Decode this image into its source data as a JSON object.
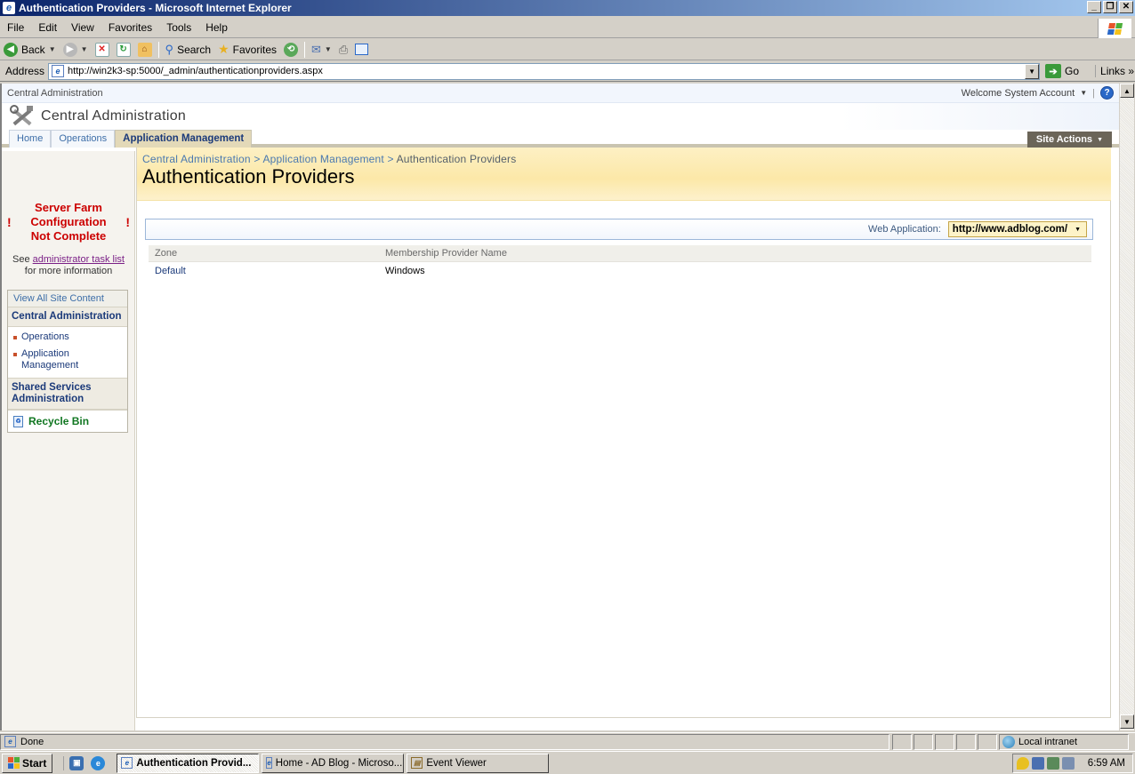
{
  "window": {
    "title": "Authentication Providers - Microsoft Internet Explorer"
  },
  "menu": [
    "File",
    "Edit",
    "View",
    "Favorites",
    "Tools",
    "Help"
  ],
  "toolbar": {
    "back": "Back",
    "search": "Search",
    "favorites": "Favorites"
  },
  "address": {
    "label": "Address",
    "url": "http://win2k3-sp:5000/_admin/authenticationproviders.aspx",
    "go": "Go",
    "links": "Links"
  },
  "sp": {
    "top_left": "Central Administration",
    "welcome": "Welcome System Account",
    "site_title": "Central Administration",
    "tabs": [
      "Home",
      "Operations",
      "Application Management"
    ],
    "active_tab": "Application Management",
    "site_actions": "Site Actions"
  },
  "leftnav": {
    "warning_lines": [
      "Server Farm",
      "Configuration",
      "Not Complete"
    ],
    "see_prefix": "See",
    "see_link": "administrator task list",
    "see_suffix": "for more information",
    "view_all": "View All Site Content",
    "central_admin": "Central Administration",
    "items": [
      "Operations",
      "Application Management"
    ],
    "shared_services": "Shared Services Administration",
    "recycle_bin": "Recycle Bin"
  },
  "main": {
    "breadcrumb": [
      "Central Administration",
      "Application Management",
      "Authentication Providers"
    ],
    "breadcrumb_sep": ">",
    "page_title": "Authentication Providers",
    "web_app_label": "Web Application:",
    "web_app_value": "http://www.adblog.com/",
    "table": {
      "headers": [
        "Zone",
        "Membership Provider Name"
      ],
      "rows": [
        [
          "Default",
          "Windows"
        ]
      ]
    }
  },
  "status": {
    "text": "Done",
    "zone": "Local intranet"
  },
  "taskbar": {
    "start": "Start",
    "tasks": [
      "Authentication Provid...",
      "Home - AD Blog - Microso...",
      "Event Viewer"
    ],
    "time": "6:59 AM"
  }
}
